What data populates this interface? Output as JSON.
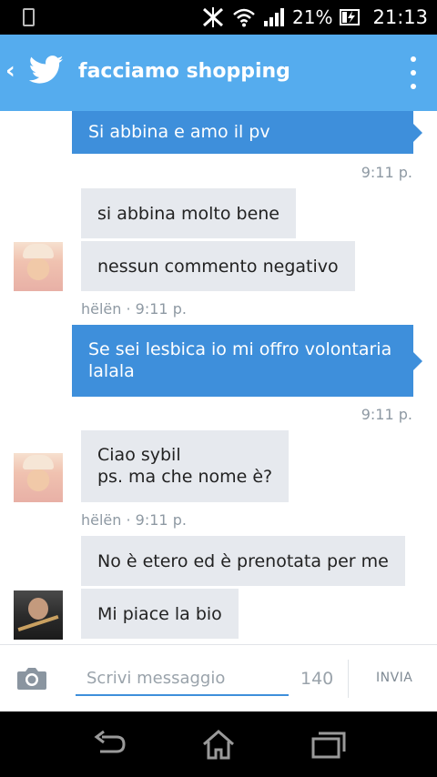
{
  "status_bar": {
    "battery_percent": "21%",
    "time": "21:13"
  },
  "header": {
    "title": "facciamo shopping"
  },
  "messages": [
    {
      "direction": "out",
      "text": "Si abbina e amo il pv",
      "time": "9:11 p."
    },
    {
      "direction": "in",
      "text": "si abbina molto bene"
    },
    {
      "direction": "in",
      "text": "nessun commento negativo",
      "meta": "hëlën · 9:11 p."
    },
    {
      "direction": "out",
      "lines": [
        "Se sei lesbica io mi offro volontaria",
        "lalala"
      ],
      "time": "9:11 p."
    },
    {
      "direction": "in",
      "lines": [
        "Ciao sybil",
        "ps. ma che nome è?"
      ],
      "meta": "hëlën · 9:11 p."
    },
    {
      "direction": "in",
      "text": "No è etero ed è prenotata per me"
    },
    {
      "direction": "in",
      "text": "Mi piace la bio"
    }
  ],
  "composer": {
    "placeholder": "Scrivi messaggio",
    "char_count": "140",
    "send_label": "INVIA"
  },
  "colors": {
    "header": "#55acee",
    "outgoing_bubble": "#3e8fdb",
    "incoming_bubble": "#e6e9ee"
  },
  "icons": [
    "phone-icon",
    "no-sound-icon",
    "wifi-icon",
    "signal-icon",
    "battery-icon",
    "back-chevron-icon",
    "twitter-bird-icon",
    "overflow-menu-icon",
    "camera-icon",
    "nav-back-icon",
    "nav-home-icon",
    "nav-recents-icon"
  ]
}
